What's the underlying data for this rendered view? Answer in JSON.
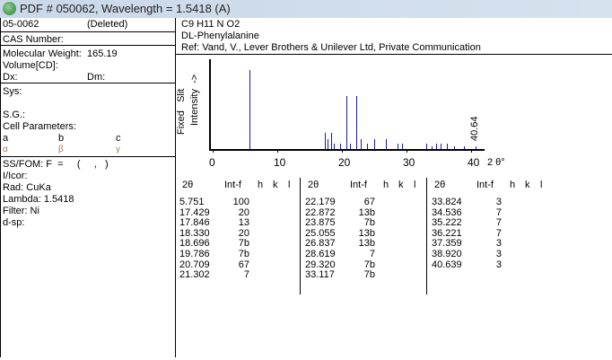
{
  "title": "PDF # 050062,  Wavelength = 1.5418    (A)",
  "left": {
    "pdf_number": "05-0062",
    "status": "(Deleted)",
    "cas": "CAS Number:",
    "mw_label": "Molecular Weight:",
    "mw_value": "165.19",
    "volume": "Volume[CD]:",
    "dx": "Dx:",
    "dm": "Dm:",
    "sys": "Sys:",
    "sg": "S.G.:",
    "cell": "Cell Parameters:",
    "a": "a",
    "b": "b",
    "c": "c",
    "alpha": "α",
    "beta": "β",
    "gamma": "γ",
    "ssfom": "SS/FOM: F  =     (     ,   )",
    "icor": "I/Icor:",
    "rad": "Rad: CuKa",
    "lambda": "Lambda: 1.5418",
    "filter": "Filter: Ni",
    "dsp": "d-sp:"
  },
  "right": {
    "formula": "C9 H11 N O2",
    "name": "DL-Phenylalanine",
    "ref": "Ref: Vand, V., Lever Brothers & Unilever Ltd, Private Communication"
  },
  "chart_data": {
    "type": "bar",
    "ylabel_1": "Fixed   Slit",
    "ylabel_2": "Intensity  ->",
    "xlabel": "2 θ°",
    "xlim": [
      0,
      42
    ],
    "ylim": [
      0,
      100
    ],
    "xticks": [
      "0",
      "10",
      "20",
      "30",
      "40"
    ],
    "annotation": "40.64",
    "x": [
      5.751,
      17.429,
      17.846,
      18.33,
      18.696,
      19.786,
      20.709,
      21.302,
      22.179,
      22.872,
      23.875,
      25.055,
      26.837,
      28.619,
      29.32,
      33.117,
      33.824,
      34.536,
      35.222,
      36.221,
      37.359,
      38.92,
      40.639
    ],
    "values": [
      100,
      20,
      13,
      20,
      7,
      7,
      67,
      7,
      67,
      13,
      7,
      13,
      13,
      7,
      7,
      7,
      3,
      7,
      7,
      7,
      3,
      3,
      3
    ]
  },
  "table": {
    "headers": {
      "two_theta": "2θ",
      "int": "Int-f",
      "h": "h",
      "k": "k",
      "l": "l"
    },
    "columns": [
      [
        [
          "5.751",
          "100"
        ],
        [
          "17.429",
          "20"
        ],
        [
          "17.846",
          "13"
        ],
        [
          "18.330",
          "20"
        ],
        [
          "18.696",
          "7b"
        ],
        [
          "19.786",
          "7b"
        ],
        [
          "20.709",
          "67"
        ],
        [
          "21.302",
          "7"
        ]
      ],
      [
        [
          "22.179",
          "67"
        ],
        [
          "22.872",
          "13b"
        ],
        [
          "23.875",
          "7b"
        ],
        [
          "25.055",
          "13b"
        ],
        [
          "26.837",
          "13b"
        ],
        [
          "28.619",
          "7"
        ],
        [
          "29.320",
          "7b"
        ],
        [
          "33.117",
          "7b"
        ]
      ],
      [
        [
          "33.824",
          "3"
        ],
        [
          "34.536",
          "7"
        ],
        [
          "35.222",
          "7"
        ],
        [
          "36.221",
          "7"
        ],
        [
          "37.359",
          "3"
        ],
        [
          "38.920",
          "3"
        ],
        [
          "40.639",
          "3"
        ]
      ]
    ]
  }
}
